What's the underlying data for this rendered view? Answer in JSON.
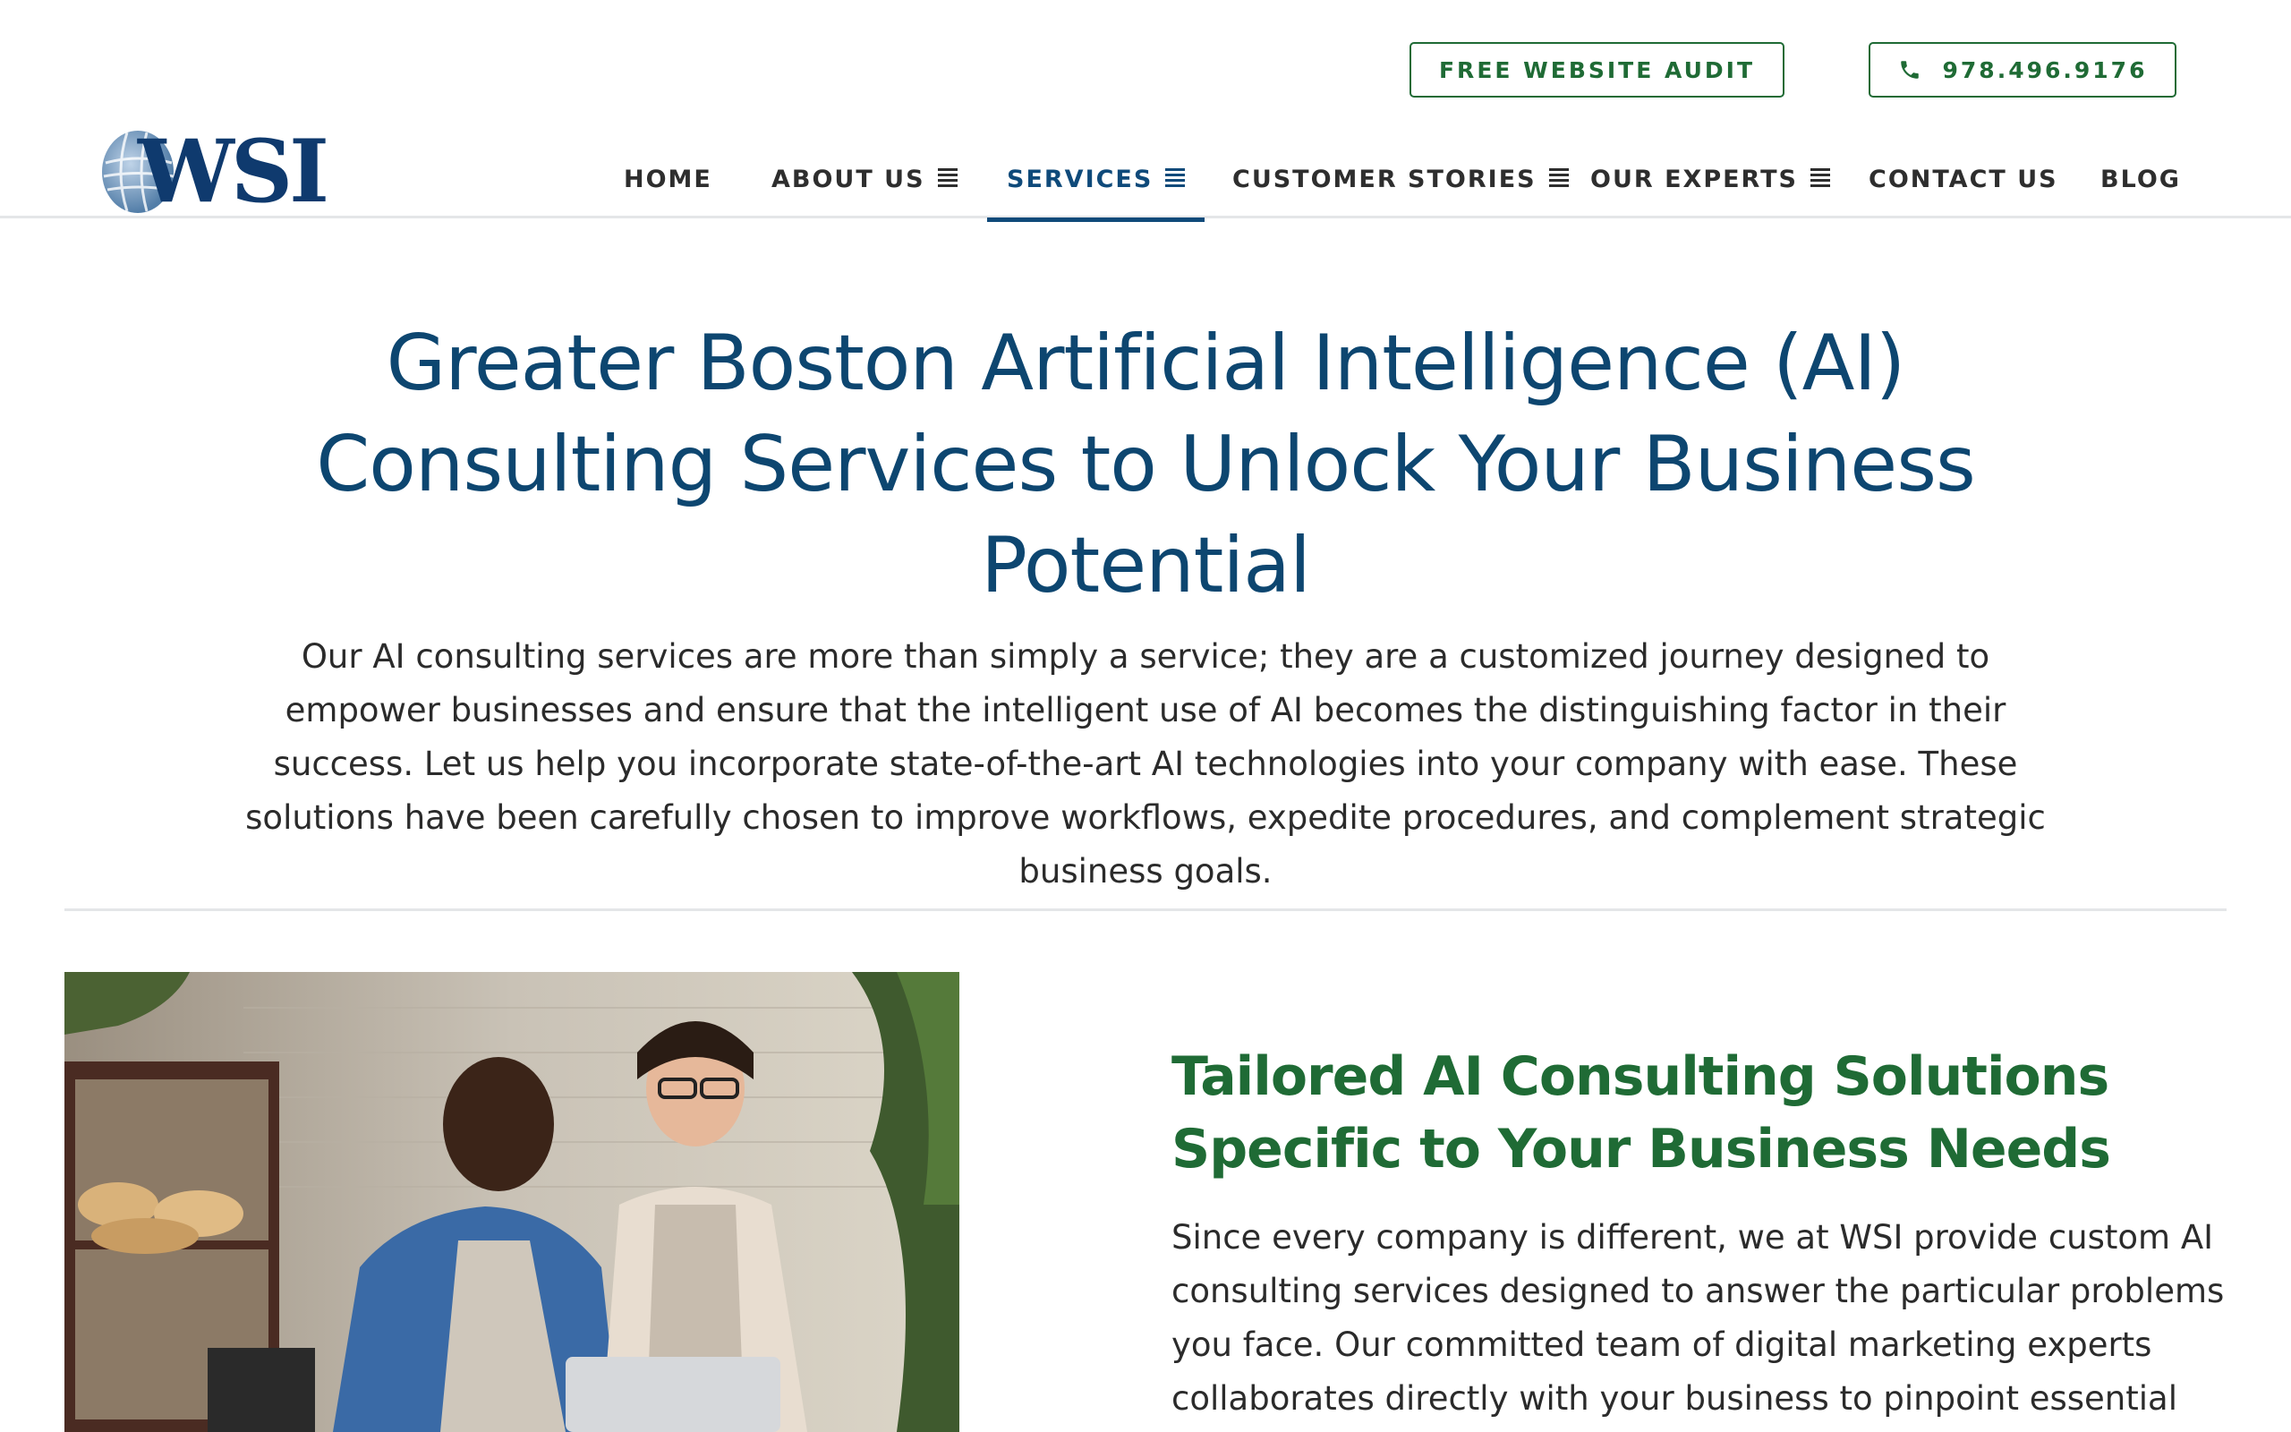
{
  "header": {
    "cta_audit": "FREE WEBSITE AUDIT",
    "cta_phone": "978.496.9176",
    "logo_text": "WSI"
  },
  "nav": [
    {
      "label": "HOME",
      "has_menu": false
    },
    {
      "label": "ABOUT US",
      "has_menu": true
    },
    {
      "label": "SERVICES",
      "has_menu": true,
      "active": true
    },
    {
      "label": "CUSTOMER STORIES",
      "has_menu": true
    },
    {
      "label": "OUR EXPERTS",
      "has_menu": true
    },
    {
      "label": "CONTACT US",
      "has_menu": false
    },
    {
      "label": "BLOG",
      "has_menu": false
    }
  ],
  "hero": {
    "title": "Greater Boston Artificial Intelligence (AI) Consulting Services to Unlock Your Business Potential",
    "text": "Our AI consulting services are more than simply a service; they are a customized journey designed to empower businesses and ensure that the intelligent use of AI becomes the distinguishing factor in their success. Let us help you incorporate state-of-the-art AI technologies into your company with ease. These solutions have been carefully chosen to improve workflows, expedite procedures, and complement strategic business goals."
  },
  "section": {
    "title": "Tailored AI Consulting Solutions Specific to Your Business Needs",
    "text": "Since every company is different, we at WSI provide custom AI consulting services designed to answer the particular problems you face. Our committed team of digital marketing experts collaborates directly with your business to pinpoint essential issues and create"
  },
  "icons": {
    "phone": "phone-icon",
    "menu": "menu-icon",
    "logo": "globe-icon"
  },
  "colors": {
    "brand_green": "#1f6b35",
    "brand_blue": "#0d4670",
    "active_nav": "#0f4a7a"
  }
}
